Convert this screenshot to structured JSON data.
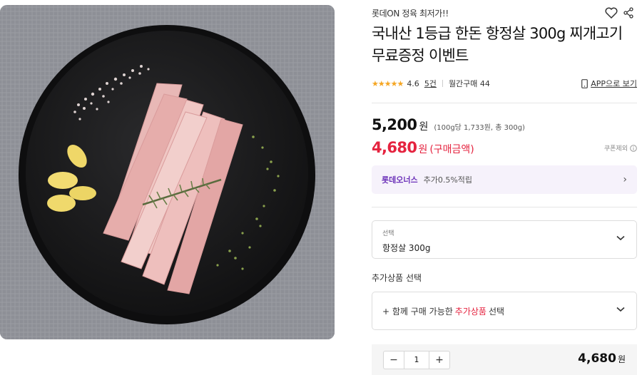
{
  "store": {
    "name": "롯데ON 정육 최저가!!"
  },
  "product": {
    "title": "국내산 1등급 한돈 항정살 300g 찌개고기 무료증정 이벤트",
    "image_alt": "항정살 on black plate"
  },
  "icons": {
    "heart": "heart-icon",
    "share": "share-icon",
    "phone": "phone-icon",
    "chevron": "chevron-down-icon",
    "info": "info-icon"
  },
  "rating": {
    "stars": "★★★★★",
    "score": "4.6",
    "reviews": "5건",
    "monthly": "월간구매 44"
  },
  "app_link": "APP으로 보기",
  "price": {
    "value": "5,200",
    "won": "원",
    "unit_info": "(100g당 1,733원, 총 300g)"
  },
  "sale": {
    "value": "4,680",
    "won": "원",
    "label": "(구매금액)",
    "coupon": "쿠폰제외"
  },
  "membership": {
    "name": "롯데오너스",
    "desc": "추가0.5%적립",
    "arrow": "›"
  },
  "option": {
    "label": "선택",
    "value": "항정살 300g"
  },
  "addon": {
    "title": "추가상품 선택",
    "prefix": "+ 함께 구매 가능한",
    "highlight": "추가상품",
    "suffix": "선택"
  },
  "quantity": {
    "minus": "−",
    "value": "1",
    "plus": "+"
  },
  "total": {
    "value": "4,680",
    "won": "원"
  },
  "colors": {
    "accent_red": "#e5233f",
    "membership_purple": "#6a2fb8",
    "star": "#f5a623"
  }
}
